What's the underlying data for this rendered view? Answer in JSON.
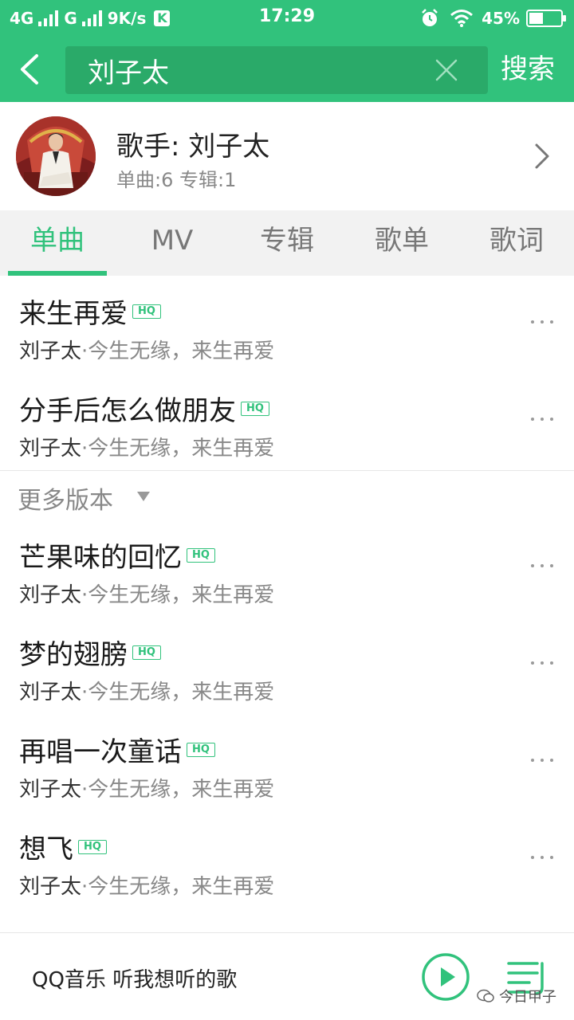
{
  "status_bar": {
    "network1": "4G",
    "network2": "G",
    "speed": "9K/s",
    "k_badge": "K",
    "time": "17:29",
    "battery": "45%",
    "battery_level": 0.45,
    "icons": [
      "signal-icon",
      "signal-icon",
      "alarm-icon",
      "wifi-icon",
      "battery-icon"
    ]
  },
  "header": {
    "search_value": "刘子太",
    "search_action": "搜索",
    "icons": [
      "back-arrow-icon",
      "clear-icon"
    ]
  },
  "artist": {
    "name": "歌手: 刘子太",
    "stats": "单曲:6 专辑:1"
  },
  "tabs": [
    {
      "label": "单曲",
      "active": true
    },
    {
      "label": "MV",
      "active": false
    },
    {
      "label": "专辑",
      "active": false
    },
    {
      "label": "歌单",
      "active": false
    },
    {
      "label": "歌词",
      "active": false
    }
  ],
  "badge": "HQ",
  "songs_top": [
    {
      "title": "来生再爱",
      "artist": "刘子太",
      "album": "·今生无缘，来生再爱"
    },
    {
      "title": "分手后怎么做朋友",
      "artist": "刘子太",
      "album": "·今生无缘，来生再爱"
    }
  ],
  "more_versions": "更多版本",
  "songs_bottom": [
    {
      "title": "芒果味的回忆",
      "artist": "刘子太",
      "album": "·今生无缘，来生再爱"
    },
    {
      "title": "梦的翅膀",
      "artist": "刘子太",
      "album": "·今生无缘，来生再爱"
    },
    {
      "title": "再唱一次童话",
      "artist": "刘子太",
      "album": "·今生无缘，来生再爱"
    },
    {
      "title": "想飞",
      "artist": "刘子太",
      "album": "·今生无缘，来生再爱"
    }
  ],
  "player": {
    "text": "QQ音乐 听我想听的歌",
    "watermark": "今日甲子"
  },
  "colors": {
    "accent": "#31c27c",
    "search_bg": "#2aaa69",
    "tab_bg": "#f2f2f2",
    "muted": "#888888"
  }
}
